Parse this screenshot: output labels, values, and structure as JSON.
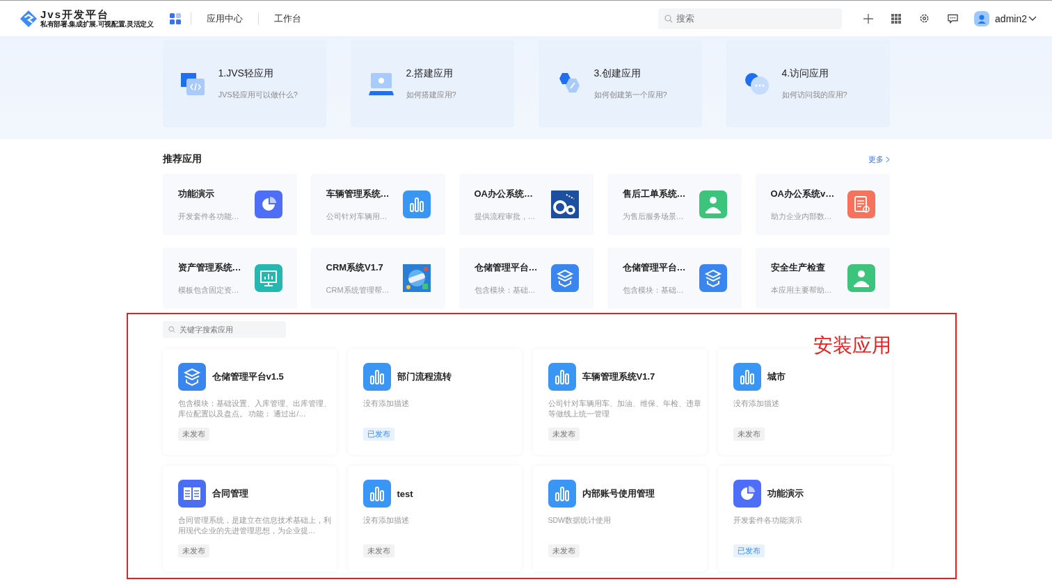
{
  "header": {
    "logo": {
      "title": "Jvs开发平台",
      "subtitle": "私有部署.集成扩展.可视配置.灵活定义"
    },
    "nav": [
      {
        "label": "应用中心",
        "selected": false
      },
      {
        "label": "工作台",
        "selected": false
      }
    ],
    "search": {
      "placeholder": "搜索"
    },
    "user": {
      "name": "admin2"
    }
  },
  "guides": [
    {
      "title": "1.JVS轻应用",
      "desc": "JVS轻应用可以做什么?",
      "kind": "code"
    },
    {
      "title": "2.搭建应用",
      "desc": "如何搭建应用?",
      "kind": "laptop"
    },
    {
      "title": "3.创建应用",
      "desc": "如何创建第一个应用?",
      "kind": "hex"
    },
    {
      "title": "4.访问应用",
      "desc": "如何访问我的应用?",
      "kind": "chat"
    }
  ],
  "recommended": {
    "title": "推荐应用",
    "more": "更多",
    "apps": [
      {
        "name": "功能演示",
        "desc": "开发套件各功能…",
        "kind": "pie",
        "color": "#4f6ef7"
      },
      {
        "name": "车辆管理系统…",
        "desc": "公司针对车辆用…",
        "kind": "bars",
        "color": "#3a96f5"
      },
      {
        "name": "OA办公系统…",
        "desc": "提供流程审批，…",
        "kind": "oa",
        "color": "#1d4fa0"
      },
      {
        "name": "售后工单系统…",
        "desc": "为售后服务场景…",
        "kind": "person",
        "color": "#3cc47c"
      },
      {
        "name": "OA办公系统v…",
        "desc": "助力企业内部数…",
        "kind": "doc",
        "color": "#f5735c"
      },
      {
        "name": "资产管理系统…",
        "desc": "模板包含固定资…",
        "kind": "monitor",
        "color": "#25b8b0"
      },
      {
        "name": "CRM系统V1.7",
        "desc": "CRM系统管理帮…",
        "kind": "picture",
        "color": "#2a7fd4"
      },
      {
        "name": "仓储管理平台…",
        "desc": "包含模块：基础…",
        "kind": "box",
        "color": "#3a86f0"
      },
      {
        "name": "仓储管理平台…",
        "desc": "包含模块：基础…",
        "kind": "box",
        "color": "#3a86f0"
      },
      {
        "name": "安全生产检查",
        "desc": "本应用主要帮助…",
        "kind": "person",
        "color": "#3cc47c"
      }
    ]
  },
  "installed": {
    "annotation": "安装应用",
    "search": {
      "placeholder": "关键字搜索应用"
    },
    "apps": [
      {
        "name": "仓储管理平台v1.5",
        "desc": "包含模块：基础设置、入库管理、出库管理、库位配置以及盘点。 功能： 通过出/…",
        "kind": "box",
        "color": "#3a86f0",
        "published": false,
        "status": "未发布"
      },
      {
        "name": "部门流程流转",
        "desc": "没有添加描述",
        "kind": "bars",
        "color": "#3a96f5",
        "published": true,
        "status": "已发布"
      },
      {
        "name": "车辆管理系统V1.7",
        "desc": "公司针对车辆用车、加油、维保、年检、违章等做线上统一管理",
        "kind": "bars",
        "color": "#3a96f5",
        "published": false,
        "status": "未发布"
      },
      {
        "name": "城市",
        "desc": "没有添加描述",
        "kind": "bars",
        "color": "#3a96f5",
        "published": false,
        "status": "未发布"
      },
      {
        "name": "合同管理",
        "desc": "合同管理系统，是建立在信息技术基础上，利用现代企业的先进管理思想，为企业提…",
        "kind": "book",
        "color": "#4a6ef2",
        "published": false,
        "status": "未发布"
      },
      {
        "name": "test",
        "desc": "没有添加描述",
        "kind": "bars",
        "color": "#3a96f5",
        "published": false,
        "status": "未发布"
      },
      {
        "name": "内部账号使用管理",
        "desc": "SDW数据统计使用",
        "kind": "bars",
        "color": "#3a96f5",
        "published": false,
        "status": "未发布"
      },
      {
        "name": "功能演示",
        "desc": "开发套件各功能演示",
        "kind": "pie",
        "color": "#4f6ef7",
        "published": true,
        "status": "已发布"
      }
    ]
  }
}
